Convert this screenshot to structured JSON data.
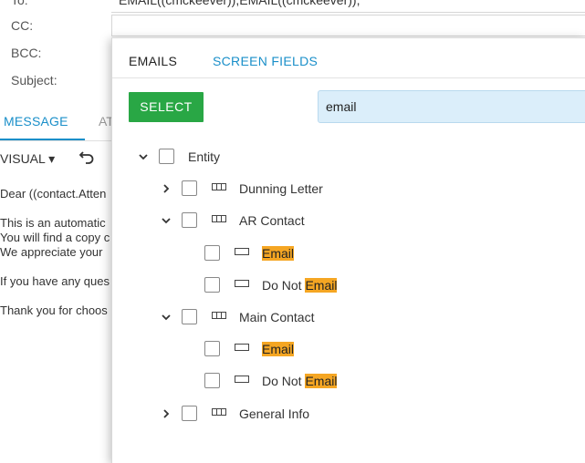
{
  "editor": {
    "to_label": "To:",
    "to_value": "EMAIL((cmckeever)),EMAIL((cmckeever)),",
    "cc_label": "CC:",
    "bcc_label": "BCC:",
    "subject_label": "Subject:",
    "tab_message": "MESSAGE",
    "tab_at": "AT",
    "visual_label": "VISUAL ▾",
    "body_lines": [
      "Dear ((contact.Atten",
      "This is an automatic",
      "You will find a copy c",
      "We appreciate your",
      "If you have any ques",
      "Thank you for choos"
    ]
  },
  "panel": {
    "tabs": {
      "emails": "EMAILS",
      "screen_fields": "SCREEN FIELDS"
    },
    "select_label": "SELECT",
    "search_value": "email",
    "tree": {
      "root": "Entity",
      "dunning": "Dunning Letter",
      "ar_contact": "AR Contact",
      "ar_email": "Email",
      "ar_do_not_prefix": "Do Not ",
      "ar_do_not_hl": "Email",
      "main_contact": "Main Contact",
      "main_email": "Email",
      "main_do_not_prefix": "Do Not ",
      "main_do_not_hl": "Email",
      "general_info": "General Info"
    }
  },
  "colors": {
    "accent": "#1a8fc9",
    "select_green": "#29a745",
    "highlight": "#f5a623",
    "search_bg": "#dbeefa"
  }
}
